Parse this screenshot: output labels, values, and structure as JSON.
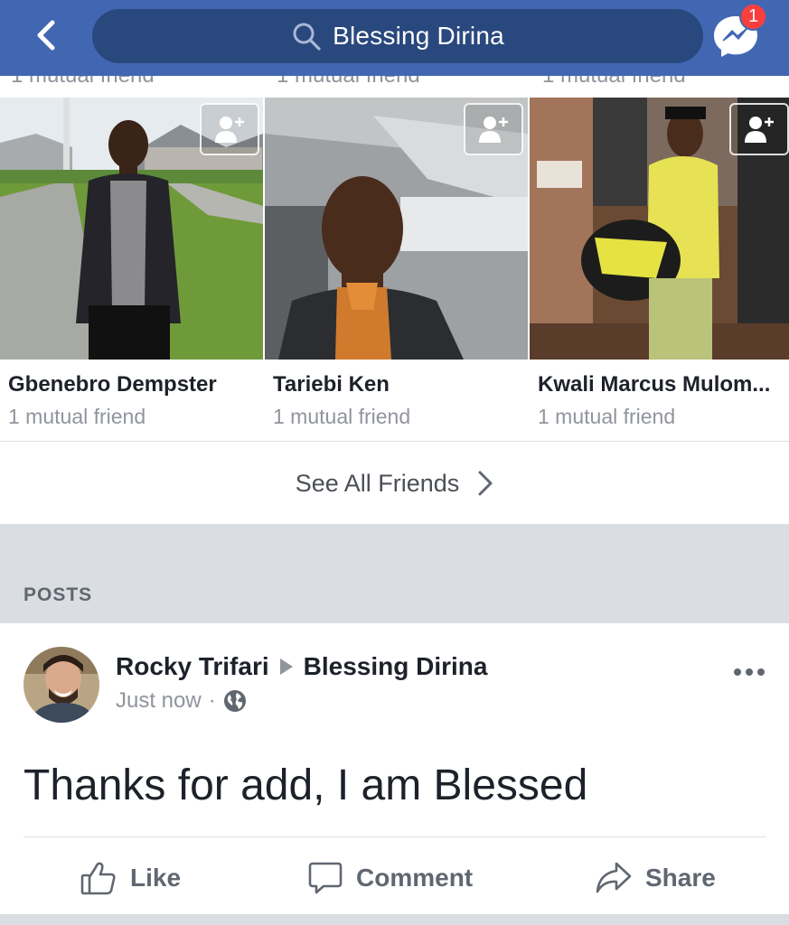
{
  "header": {
    "search_text": "Blessing Dirina",
    "messenger_badge": "1",
    "colors": {
      "bar": "#4267b2",
      "search_pill": "#29487d",
      "badge": "#fa3e3e"
    }
  },
  "clipped_row": [
    "1 mutual friend",
    "1 mutual friend",
    "1 mutual friend"
  ],
  "friends": [
    {
      "name": "Gbenebro Dempster",
      "mutual": "1 mutual friend"
    },
    {
      "name": "Tariebi Ken",
      "mutual": "1 mutual friend"
    },
    {
      "name": "Kwali Marcus Mulom...",
      "mutual": "1 mutual friend"
    }
  ],
  "see_all": {
    "label": "See All Friends"
  },
  "posts_section": {
    "label": "POSTS"
  },
  "post": {
    "author": "Rocky Trifari",
    "target": "Blessing Dirina",
    "time": "Just now",
    "separator": "·",
    "privacy_icon": "globe-icon",
    "text": "Thanks for add, I am Blessed",
    "actions": {
      "like": "Like",
      "comment": "Comment",
      "share": "Share"
    }
  }
}
